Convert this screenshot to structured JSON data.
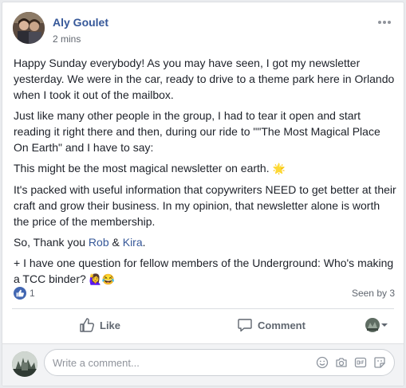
{
  "post": {
    "author": "Aly Goulet",
    "time": "2 mins",
    "paragraphs": {
      "p1": "Happy Sunday everybody! As you may have seen, I got my newsletter yesterday. We were in the car, ready to drive to a theme park here in Orlando when I took it out of the mailbox.",
      "p2": "Just like many other people in the group, I had to tear it open and start reading it right there and then, during our ride to \"\"The Most Magical Place On Earth\" and I have to say:",
      "p3": "This might be the most magical newsletter on earth.",
      "p3_emoji": "🌟",
      "p4": "It's packed with useful information that copywriters NEED to get better at their craft and grow their business. In my opinion, that newsletter alone is worth the price of the membership.",
      "p5_prefix": "So, Thank you ",
      "mention1": "Rob",
      "p5_and": " & ",
      "mention2": "Kira",
      "p5_suffix": ".",
      "p6": "+ I have one question for fellow members of the Underground: Who's making a TCC binder?",
      "p6_emoji": "🙋‍♀️😂"
    }
  },
  "reactions": {
    "count": "1",
    "seen_by": "Seen by 3"
  },
  "actions": {
    "like_label": "Like",
    "comment_label": "Comment"
  },
  "comment_input": {
    "placeholder": "Write a comment..."
  },
  "icons": {
    "more": "more-horizontal-icon",
    "like": "thumbs-up-icon",
    "comment": "speech-bubble-icon",
    "emoji": "smiley-icon",
    "camera": "camera-icon",
    "gif": "gif-icon",
    "sticker": "sticker-icon"
  },
  "colors": {
    "link": "#365899",
    "like_blue": "#4267b2",
    "muted": "#616770"
  }
}
